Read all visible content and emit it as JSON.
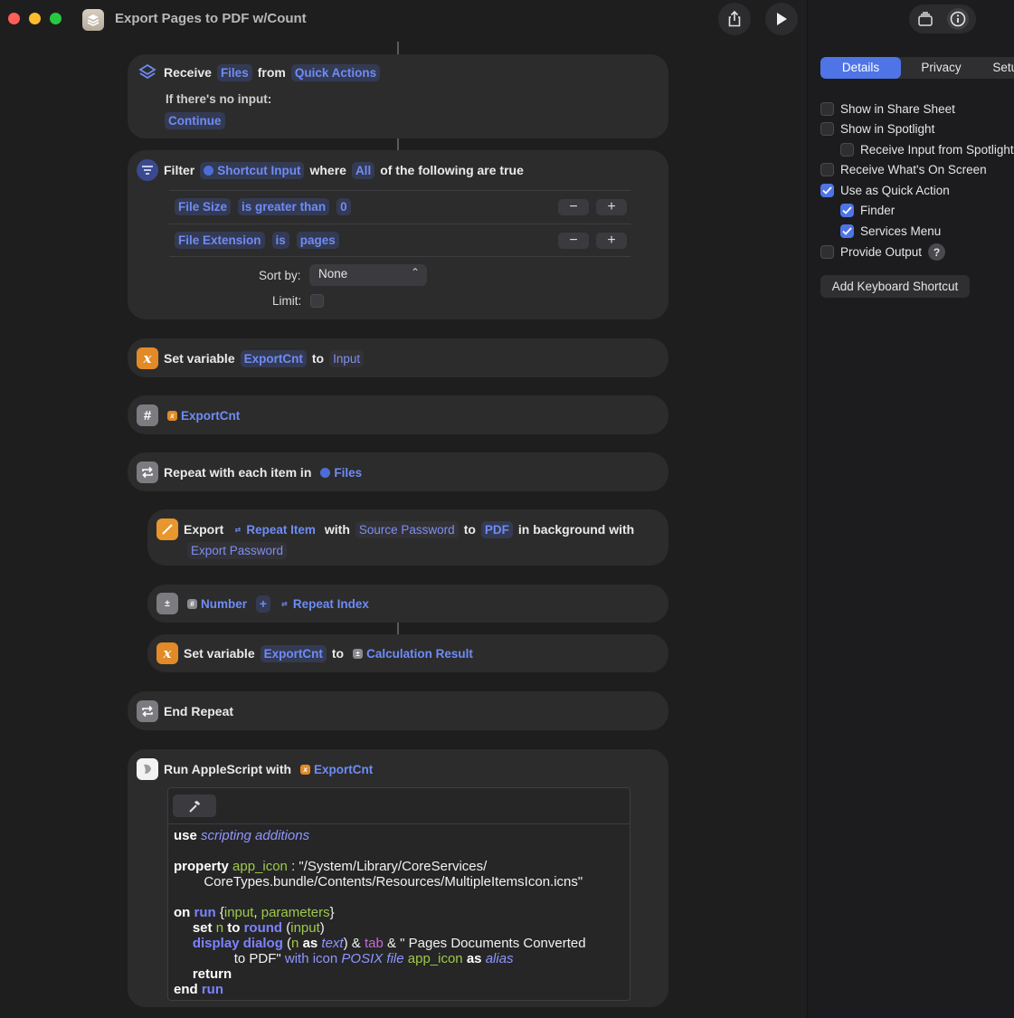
{
  "window": {
    "title": "Export Pages to PDF w/Count"
  },
  "receive": {
    "verb": "Receive",
    "input_type": "Files",
    "from": "from",
    "source": "Quick Actions",
    "no_input_label": "If there's no input:",
    "no_input_action": "Continue"
  },
  "filter": {
    "verb": "Filter",
    "target": "Shortcut Input",
    "where": "where",
    "mode": "All",
    "tail": "of the following are true",
    "rows": [
      {
        "property": "File Size",
        "operator": "is greater than",
        "value": "0"
      },
      {
        "property": "File Extension",
        "operator": "is",
        "value": "pages"
      }
    ],
    "sort_label": "Sort by:",
    "sort_value": "None",
    "limit_label": "Limit:"
  },
  "set_var_1": {
    "verb": "Set variable",
    "name": "ExportCnt",
    "to": "to",
    "value": "Input"
  },
  "number_action": {
    "variable": "ExportCnt"
  },
  "repeat": {
    "verb": "Repeat with each item in",
    "collection": "Files"
  },
  "export_action": {
    "verb": "Export",
    "item": "Repeat Item",
    "with": "with",
    "password": "Source Password",
    "to": "to",
    "format": "PDF",
    "tail": "in background with",
    "export_password": "Export Password"
  },
  "calc_action": {
    "left": "Number",
    "op": "+",
    "right": "Repeat Index"
  },
  "set_var_2": {
    "verb": "Set variable",
    "name": "ExportCnt",
    "to": "to",
    "value": "Calculation Result"
  },
  "end_repeat": {
    "label": "End Repeat"
  },
  "applescript": {
    "verb": "Run AppleScript with",
    "input": "ExportCnt",
    "lines": {
      "l1a": "use",
      "l1b": "scripting additions",
      "l2a": "property",
      "l2b": "app_icon",
      "l2c": " : \"/System/Library/CoreServices/",
      "l3": "CoreTypes.bundle/Contents/Resources/MultipleItemsIcon.icns\"",
      "l4a": "on",
      "l4b": "run",
      "l4c": "{",
      "l4d": "input",
      "l4e": ", ",
      "l4f": "parameters",
      "l4g": "}",
      "l5a": "set",
      "l5b": "n",
      "l5c": "to",
      "l5d": "round",
      "l5e": "(",
      "l5f": "input",
      "l5g": ")",
      "l6a": "display dialog",
      "l6b": "(",
      "l6c": "n",
      "l6d": "as",
      "l6e": "text",
      "l6f": ") & ",
      "l6g": "tab",
      "l6h": " & \" Pages Documents Converted",
      "l7a": "to PDF\" ",
      "l7b": "with icon",
      "l7c": "POSIX file",
      "l7d": "app_icon",
      "l7e": "as",
      "l7f": "alias",
      "l8": "return",
      "l9a": "end",
      "l9b": "run"
    }
  },
  "inspector": {
    "tabs": [
      "Details",
      "Privacy",
      "Setup"
    ],
    "options": [
      {
        "label": "Show in Share Sheet",
        "checked": false
      },
      {
        "label": "Show in Spotlight",
        "checked": false
      },
      {
        "label": "Receive Input from Spotlight",
        "checked": false
      },
      {
        "label": "Receive What's On Screen",
        "checked": false
      },
      {
        "label": "Use as Quick Action",
        "checked": true
      },
      {
        "label": "Finder",
        "checked": true
      },
      {
        "label": "Services Menu",
        "checked": true
      },
      {
        "label": "Provide Output",
        "checked": false
      }
    ],
    "help_label": "?",
    "keyboard_button": "Add Keyboard Shortcut"
  }
}
